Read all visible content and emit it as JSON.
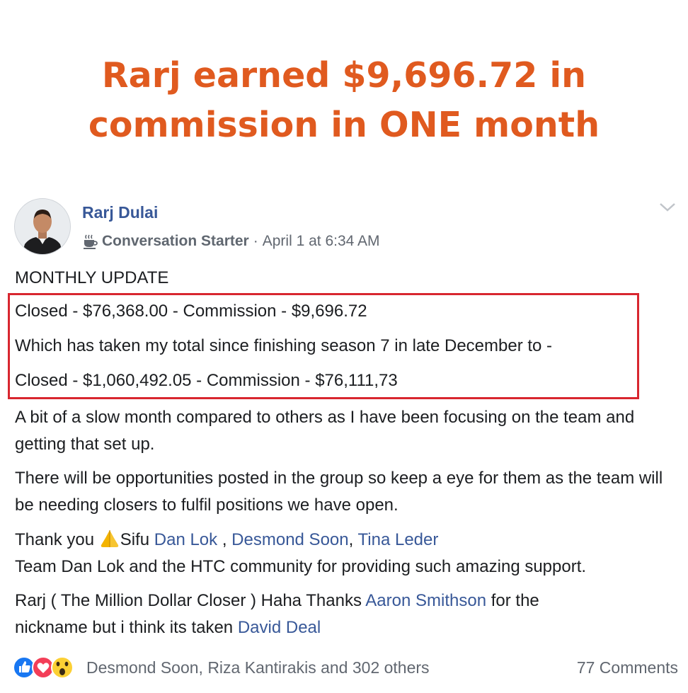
{
  "headline": {
    "line1": "Rarj earned $9,696.72 in",
    "line2": "commission in ONE month",
    "color": "#e05a1f"
  },
  "post": {
    "author": "Rarj Dulai",
    "badge_icon": "coffee-cup-icon",
    "badge_label": "Conversation Starter",
    "separator": "·",
    "timestamp": "April 1 at 6:34 AM",
    "menu_icon": "chevron-down-icon",
    "title_line": "MONTHLY UPDATE",
    "highlighted": [
      "Closed - $76,368.00 - Commission - $9,696.72",
      "Which has taken my total since finishing season 7 in late December to -",
      "Closed - $1,060,492.05 - Commission - $76,111,73"
    ],
    "para1": "A bit of a slow month compared to others as I have been focusing on the team and getting that set up.",
    "para2": "There will be opportunities posted in the group so keep a eye for them as the team will be needing closers to fulfil positions we have open.",
    "thanks": {
      "prefix": "Thank you ",
      "emoji_icon": "praying-hands-icon",
      "sifu": "Sifu ",
      "mention1": "Dan Lok",
      "sep1": " , ",
      "mention2": "Desmond Soon",
      "sep2": ", ",
      "mention3": "Tina Leder",
      "line2": "Team Dan Lok and the HTC community for providing such amazing support."
    },
    "closing": {
      "part1": "Rarj ( The Million Dollar Closer ) Haha Thanks ",
      "mention1": "Aaron Smithson",
      "part2": " for the",
      "part3": "nickname but i think its taken ",
      "mention2": "David Deal"
    }
  },
  "footer": {
    "reaction_icons": [
      "like-icon",
      "love-icon",
      "wow-icon"
    ],
    "reactions_text": "Desmond Soon, Riza Kantirakis and 302 others",
    "comments": "77 Comments"
  },
  "colors": {
    "link": "#385898",
    "highlight_border": "#d8262f",
    "meta": "#616770"
  }
}
